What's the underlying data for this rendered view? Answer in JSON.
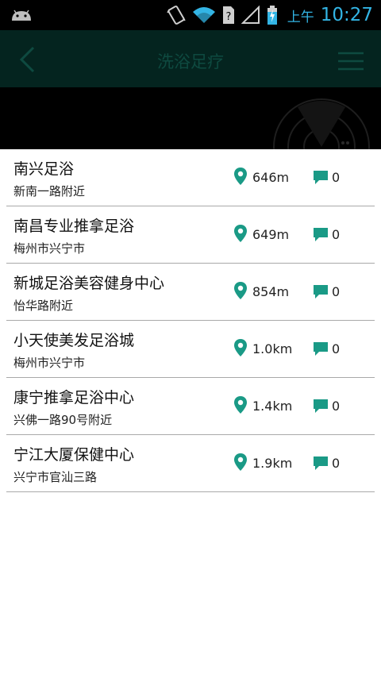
{
  "status_bar": {
    "icons": [
      "android-icon",
      "vibrate-icon",
      "wifi-icon",
      "sim-unknown-icon",
      "signal-icon",
      "battery-charging-icon"
    ],
    "ampm": "上午",
    "time": "10:27",
    "accent": "#33b5e5"
  },
  "nav": {
    "title": "洗浴足疗",
    "back_icon": "chevron-left-icon",
    "menu_icon": "hamburger-menu-icon"
  },
  "banner": {
    "icon": "radar-icon"
  },
  "places": [
    {
      "name": "南兴足浴",
      "addr": "新南一路附近",
      "dist": "646m",
      "count": "0"
    },
    {
      "name": "南昌专业推拿足浴",
      "addr": "梅州市兴宁市",
      "dist": "649m",
      "count": "0"
    },
    {
      "name": "新城足浴美容健身中心",
      "addr": "怡华路附近",
      "dist": "854m",
      "count": "0"
    },
    {
      "name": "小天使美发足浴城",
      "addr": "梅州市兴宁市",
      "dist": "1.0km",
      "count": "0"
    },
    {
      "name": "康宁推拿足浴中心",
      "addr": "兴佛一路90号附近",
      "dist": "1.4km",
      "count": "0"
    },
    {
      "name": "宁江大厦保健中心",
      "addr": "兴宁市官汕三路",
      "dist": "1.9km",
      "count": "0"
    }
  ],
  "colors": {
    "icon_teal": "#1a9a86",
    "nav_bg": "#04241f",
    "divider": "#a9a9a9"
  }
}
